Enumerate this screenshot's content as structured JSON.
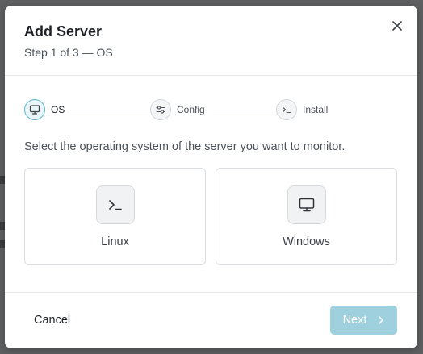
{
  "dialog": {
    "title": "Add Server",
    "subtitle": "Step 1 of 3 — OS"
  },
  "stepper": {
    "steps": [
      {
        "label": "OS",
        "icon": "monitor-icon",
        "active": true
      },
      {
        "label": "Config",
        "icon": "sliders-icon",
        "active": false
      },
      {
        "label": "Install",
        "icon": "terminal-icon",
        "active": false
      }
    ]
  },
  "prompt": "Select the operating system of the server you want to monitor.",
  "options": [
    {
      "label": "Linux",
      "icon": "terminal-icon"
    },
    {
      "label": "Windows",
      "icon": "monitor-icon"
    }
  ],
  "footer": {
    "cancel_label": "Cancel",
    "next_label": "Next",
    "next_icon": "chevron-right-icon"
  },
  "colors": {
    "accent": "#5bb3c9",
    "next_button_disabled": "#9fd0de"
  }
}
